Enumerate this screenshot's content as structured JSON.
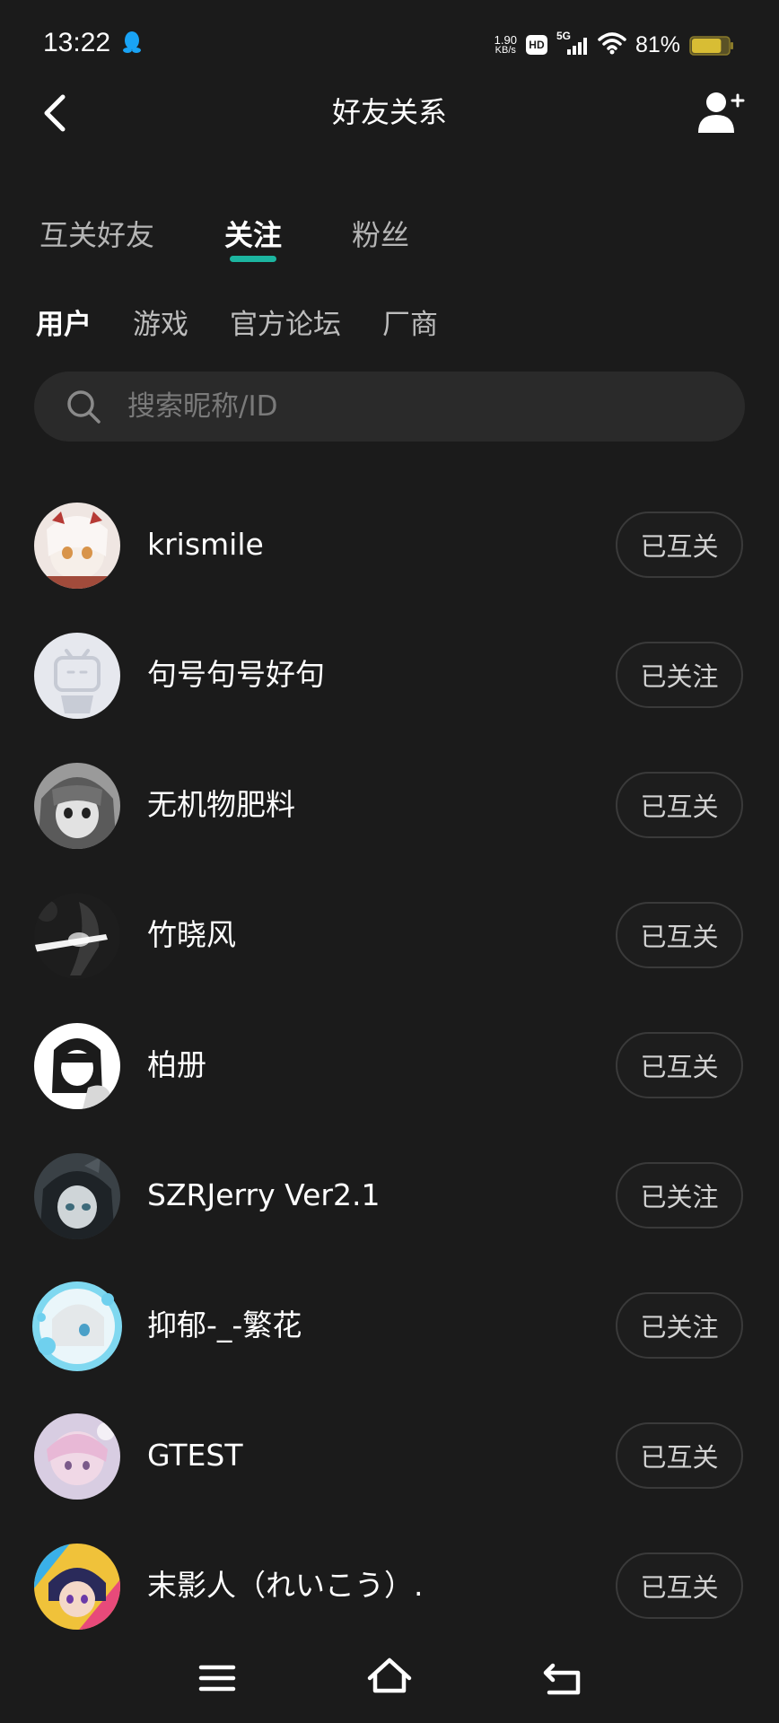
{
  "status_bar": {
    "time": "13:22",
    "net_speed_value": "1.90",
    "net_speed_unit": "KB/s",
    "hd": "HD",
    "signal": "5G",
    "battery": "81%",
    "battery_level": 0.81
  },
  "header": {
    "title": "好友关系"
  },
  "main_tabs": [
    {
      "label": "互关好友",
      "active": false
    },
    {
      "label": "关注",
      "active": true
    },
    {
      "label": "粉丝",
      "active": false
    }
  ],
  "sub_tabs": [
    {
      "label": "用户",
      "active": true
    },
    {
      "label": "游戏",
      "active": false
    },
    {
      "label": "官方论坛",
      "active": false
    },
    {
      "label": "厂商",
      "active": false
    }
  ],
  "search": {
    "placeholder": "搜索昵称/ID"
  },
  "users": [
    {
      "name": "krismile",
      "status": "已互关"
    },
    {
      "name": "句号句号好句",
      "status": "已关注"
    },
    {
      "name": "无机物肥料",
      "status": "已互关"
    },
    {
      "name": "竹晓风",
      "status": "已互关"
    },
    {
      "name": "柏册",
      "status": "已互关"
    },
    {
      "name": "SZRJerry Ver2.1",
      "status": "已关注"
    },
    {
      "name": "抑郁-_-繁花",
      "status": "已关注"
    },
    {
      "name": "GTEST",
      "status": "已互关"
    },
    {
      "name": "末影人（れいこう）.",
      "status": "已互关"
    }
  ],
  "colors": {
    "background": "#1b1b1b",
    "accent": "#1cb5a0",
    "search_bg": "#2a2a2a"
  }
}
